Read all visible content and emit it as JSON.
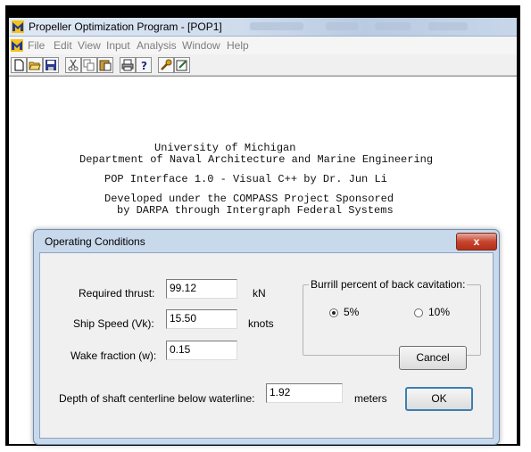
{
  "window": {
    "title": "Propeller Optimization Program - [POP1]"
  },
  "menubar": {
    "items": [
      "File",
      "Edit",
      "View",
      "Input",
      "Analysis",
      "Window",
      "Help"
    ]
  },
  "toolbar": {
    "buttons": [
      "new-icon",
      "open-icon",
      "save-icon",
      "cut-icon",
      "copy-icon",
      "paste-icon",
      "print-icon",
      "help-icon",
      "wrench-icon",
      "edit-icon"
    ]
  },
  "document": {
    "lines": [
      "University of Michigan",
      "Department of Naval Architecture and Marine Engineering",
      "POP Interface 1.0 - Visual C++ by Dr. Jun Li",
      "Developed under the COMPASS Project Sponsored",
      "by DARPA through Intergraph Federal Systems"
    ]
  },
  "dialog": {
    "title": "Operating Conditions",
    "close_label": "x",
    "fields": {
      "thrust": {
        "label": "Required thrust:",
        "value": "99.12",
        "unit": "kN"
      },
      "speed": {
        "label": "Ship Speed (Vk):",
        "value": "15.50",
        "unit": "knots"
      },
      "wake": {
        "label": "Wake fraction (w):",
        "value": "0.15"
      },
      "depth": {
        "label": "Depth of shaft centerline below waterline:",
        "value": "1.92",
        "unit": "meters"
      }
    },
    "cavitation": {
      "title": "Burrill percent of back cavitation:",
      "options": [
        "5%",
        "10%"
      ],
      "selected": "5%"
    },
    "buttons": {
      "cancel": "Cancel",
      "ok": "OK"
    }
  },
  "colors": {
    "titlebar": "#cfdcec",
    "dialog_frame": "#c9d9ec",
    "close_button": "#c7452f",
    "default_button_border": "#3c7fb1"
  }
}
